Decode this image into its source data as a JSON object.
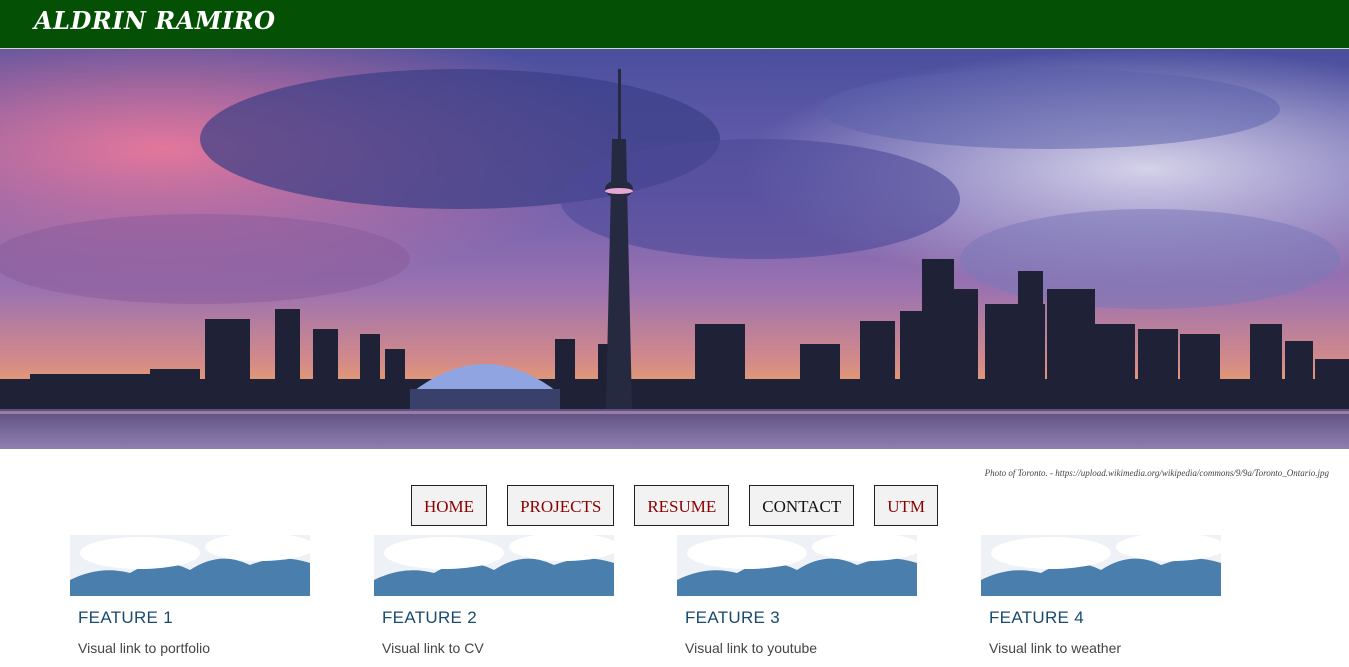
{
  "header": {
    "brand": "ALDRIN RAMIRO"
  },
  "hero": {
    "alt": "Toronto skyline at sunset",
    "caption": "Photo of Toronto. - https://upload.wikimedia.org/wikipedia/commons/9/9a/Toronto_Ontario.jpg"
  },
  "nav": {
    "items": [
      {
        "label": "HOME"
      },
      {
        "label": "PROJECTS"
      },
      {
        "label": "RESUME"
      },
      {
        "label": "CONTACT"
      },
      {
        "label": "UTM"
      }
    ],
    "active": "CONTACT"
  },
  "features": [
    {
      "title": "FEATURE 1",
      "desc": "Visual link to portfolio"
    },
    {
      "title": "FEATURE 2",
      "desc": "Visual link to CV"
    },
    {
      "title": "FEATURE 3",
      "desc": "Visual link to youtube"
    },
    {
      "title": "FEATURE 4",
      "desc": "Visual link to weather"
    }
  ],
  "colors": {
    "header_bg": "#045004",
    "nav_text": "#8b0000",
    "feature_title": "#1a4a6e"
  }
}
